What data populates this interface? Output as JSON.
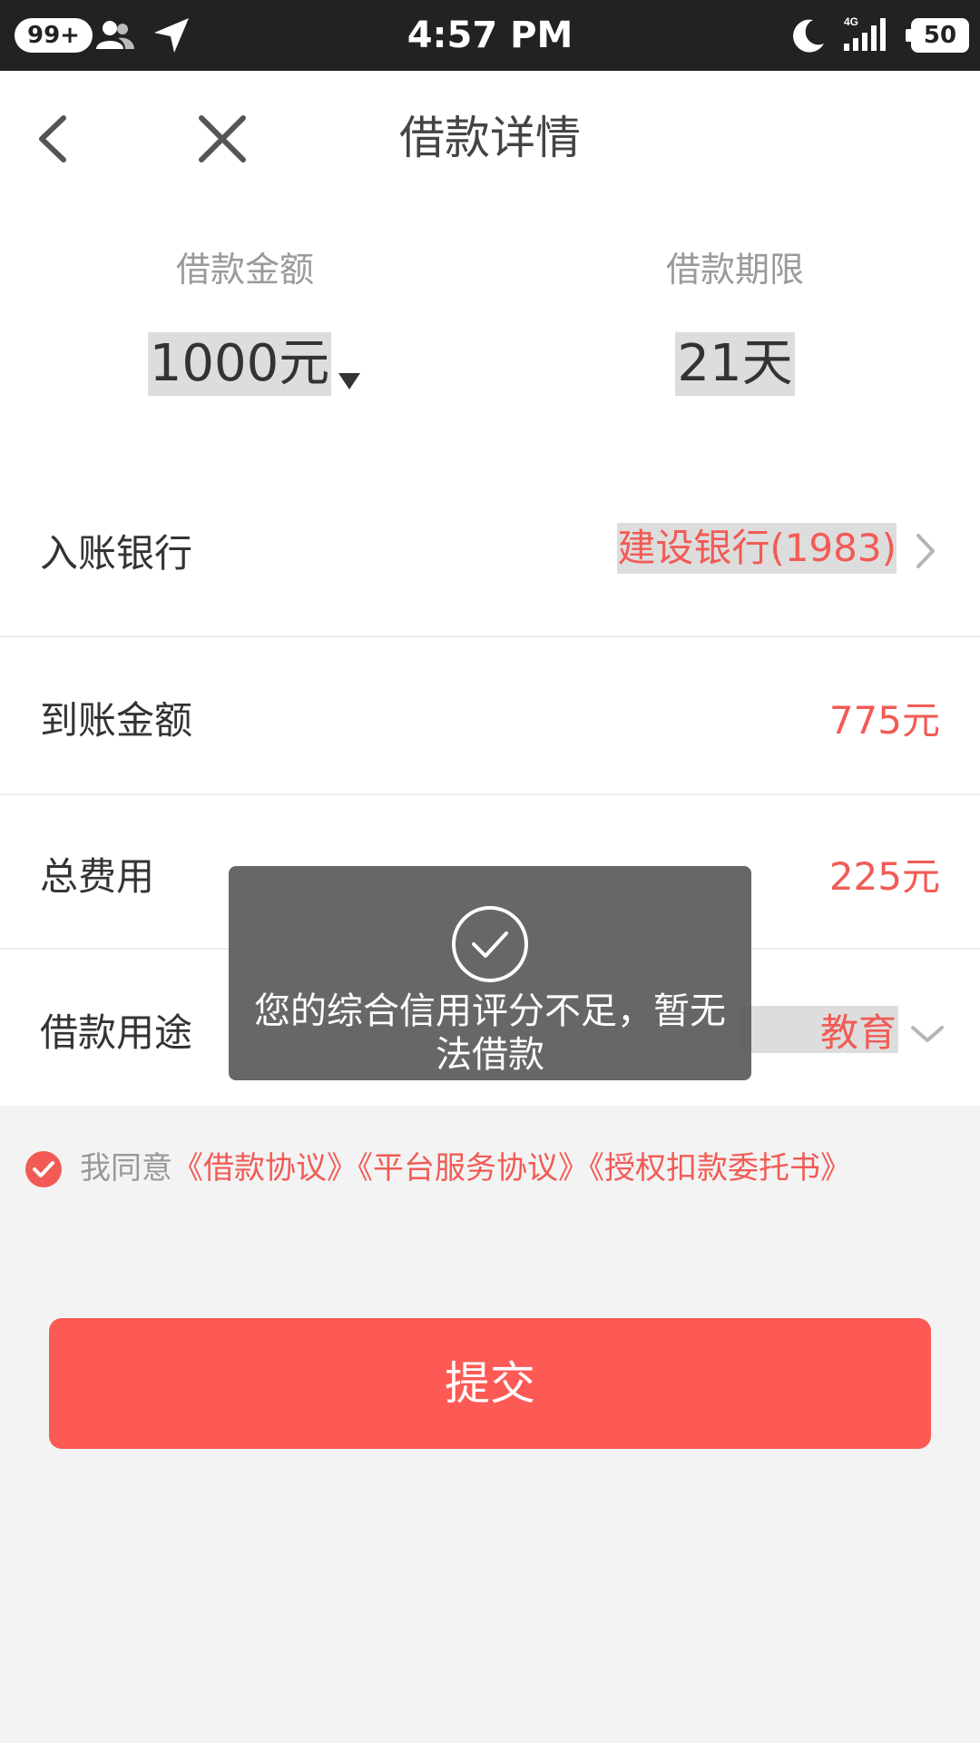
{
  "status_bar": {
    "notification_badge": "99+",
    "time": "4:57 PM",
    "network": "4G",
    "battery": "50"
  },
  "header": {
    "title": "借款详情"
  },
  "loan": {
    "amount_label": "借款金额",
    "amount_value": "1000元",
    "term_label": "借款期限",
    "term_value": "21天"
  },
  "rows": [
    {
      "label": "入账银行",
      "value": "建设银行(1983)"
    },
    {
      "label": "到账金额",
      "value": "775元"
    },
    {
      "label": "总费用",
      "value": "225元"
    },
    {
      "label": "借款用途",
      "value": "教育"
    }
  ],
  "agreement": {
    "prefix": "我同意",
    "links": [
      "《借款协议》",
      "《平台服务协议》",
      "《授权扣款委托书》"
    ]
  },
  "submit_label": "提交",
  "toast": {
    "message": "您的综合信用评分不足，暂无法借款"
  },
  "colors": {
    "accent": "#fd5a55",
    "value_red": "#f25b55",
    "status_bar": "#222222"
  }
}
